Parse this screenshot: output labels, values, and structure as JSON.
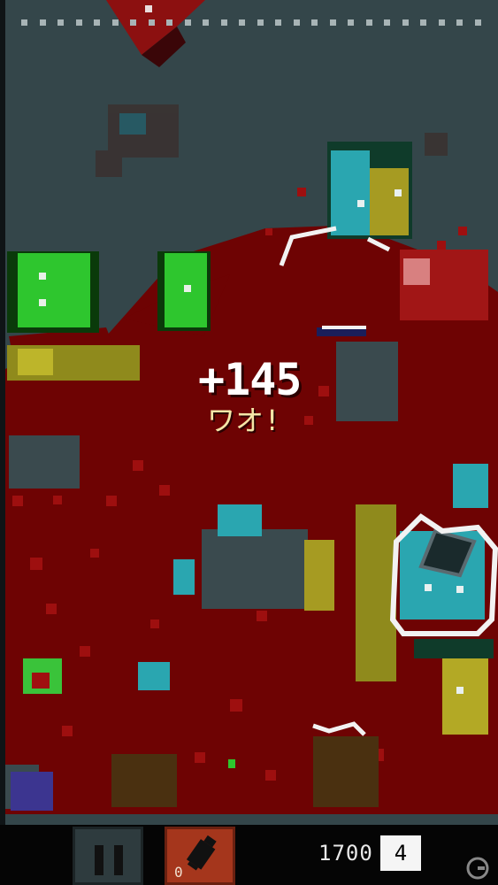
{
  "popup": {
    "points": "+145",
    "exclaim": "ワオ!"
  },
  "hud": {
    "score": "1700",
    "multiplier": "4",
    "bomb_count": "0"
  },
  "icons": {
    "pause": "pause-icon",
    "bomb": "bomb-icon",
    "watermark": "gamer-logo-icon"
  },
  "colors": {
    "board": "#34464a",
    "blood": "#6e0303",
    "hud": "#050505",
    "bomb_button": "#a5361c"
  }
}
